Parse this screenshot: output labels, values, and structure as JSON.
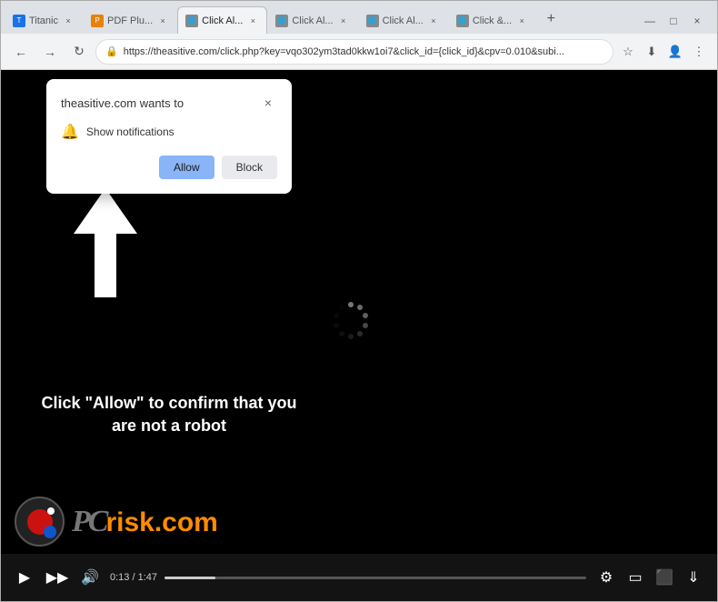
{
  "browser": {
    "tabs": [
      {
        "id": "tab1",
        "label": "Titanic",
        "favicon": "blue",
        "active": false
      },
      {
        "id": "tab2",
        "label": "PDF Plu...",
        "favicon": "orange",
        "active": false
      },
      {
        "id": "tab3",
        "label": "Click Al...",
        "favicon": "gray",
        "active": true
      },
      {
        "id": "tab4",
        "label": "Click Al...",
        "favicon": "gray",
        "active": false
      },
      {
        "id": "tab5",
        "label": "Click Al...",
        "favicon": "gray",
        "active": false
      },
      {
        "id": "tab6",
        "label": "Click &...",
        "favicon": "gray",
        "active": false
      }
    ],
    "address": "https://theasitive.com/click.php?key=vqo302ym3tad0kkw1oi7&click_id={click_id}&cpv=0.010&subi...",
    "back_disabled": false,
    "forward_disabled": false
  },
  "popup": {
    "title": "theasitive.com wants to",
    "notification_label": "Show notifications",
    "allow_label": "Allow",
    "block_label": "Block"
  },
  "main_content": {
    "instruction_text": "Click \"Allow\" to confirm that you are not a robot",
    "spinner_visible": true
  },
  "video_controls": {
    "time_current": "0:13",
    "time_total": "1:47",
    "time_display": "0:13 / 1:47"
  },
  "pcrisk": {
    "domain": "risk.com",
    "prefix": "PC"
  }
}
